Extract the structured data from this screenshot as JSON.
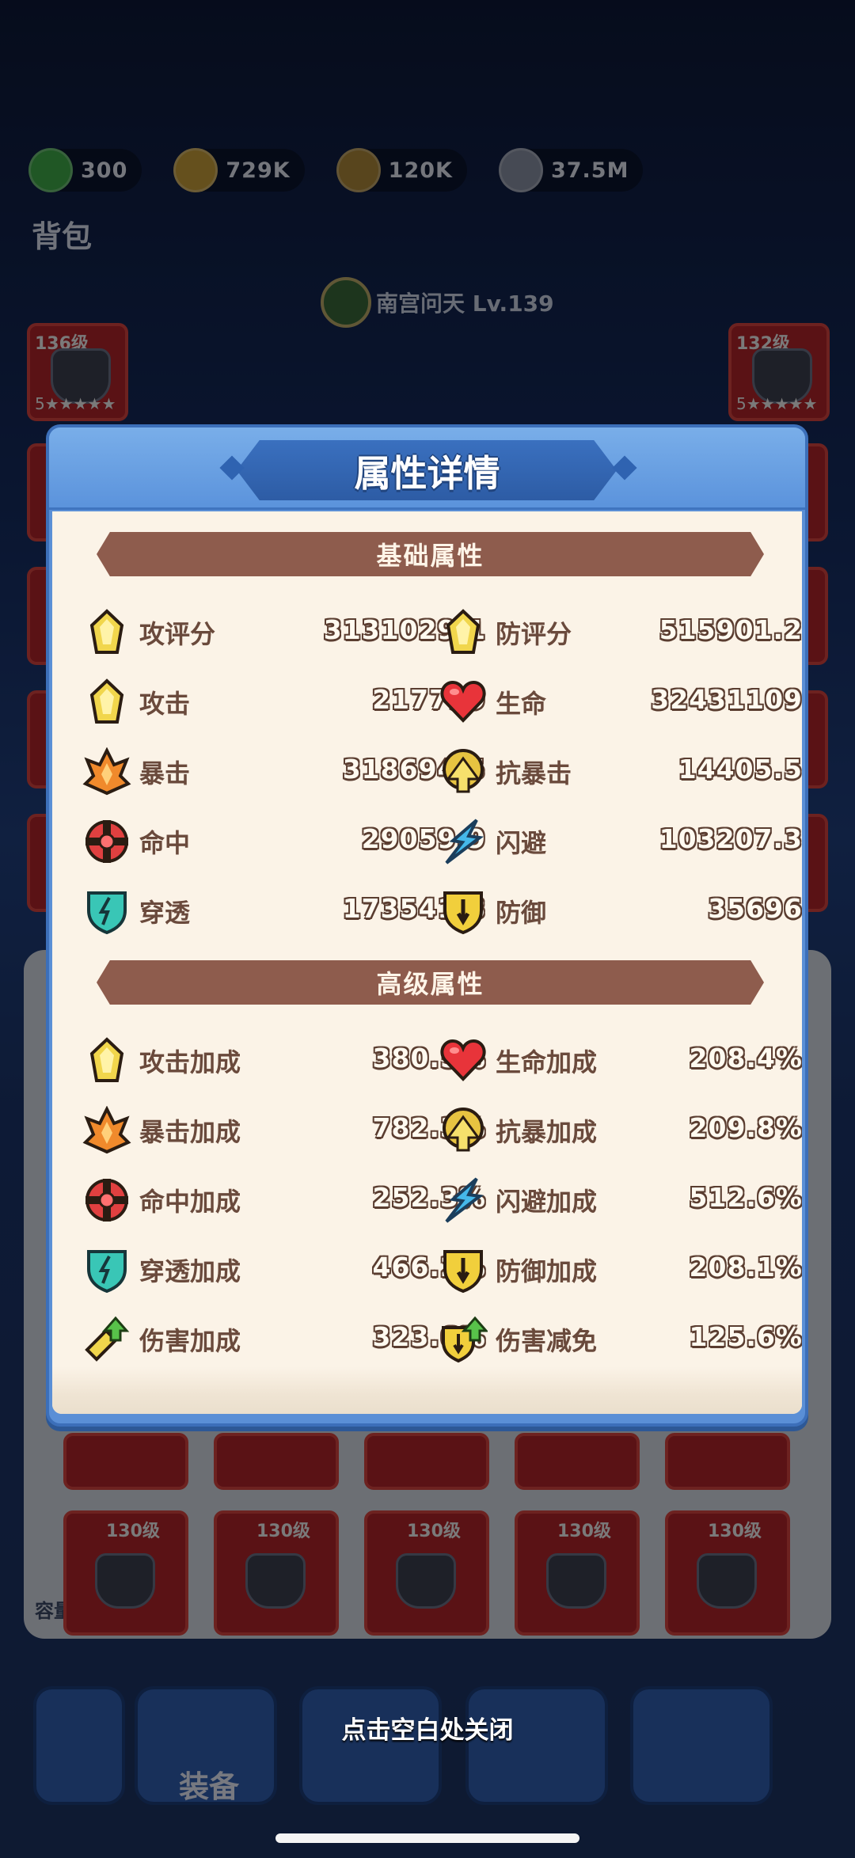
{
  "resources": [
    {
      "icon": "green-gem-icon",
      "value": "300",
      "color": "#3fae4a"
    },
    {
      "icon": "gold-coin-icon",
      "value": "729K",
      "color": "#caa13a"
    },
    {
      "icon": "bronze-coin-icon",
      "value": "120K",
      "color": "#b08a3a"
    },
    {
      "icon": "silver-coin-icon",
      "value": "37.5M",
      "color": "#8c93a8"
    }
  ],
  "bag_title": "背包",
  "hero": {
    "name": "南宫问天 Lv.139"
  },
  "equipment_slots": [
    {
      "level": "136级",
      "stars": "5★★★★★"
    },
    {
      "level": "132级",
      "stars": "5★★★★★"
    }
  ],
  "bottom_slots": [
    {
      "level": "130级"
    },
    {
      "level": "130级"
    },
    {
      "level": "130级"
    },
    {
      "level": "130级"
    },
    {
      "level": "130级"
    }
  ],
  "capacity": "容量: 189/300",
  "nav": {
    "equipment_label": "装备"
  },
  "modal": {
    "title": "属性详情",
    "basic_section": "基础属性",
    "advanced_section": "高级属性",
    "basic_stats": [
      {
        "left": {
          "icon": "attack-score-icon",
          "name": "攻评分",
          "value": "3131029.1"
        },
        "right": {
          "icon": "defense-score-icon",
          "name": "防评分",
          "value": "515901.2"
        }
      },
      {
        "left": {
          "icon": "attack-icon",
          "name": "攻击",
          "value": "217799"
        },
        "right": {
          "icon": "heart-icon",
          "name": "生命",
          "value": "32431109"
        }
      },
      {
        "left": {
          "icon": "crit-icon",
          "name": "暴击",
          "value": "318694.5"
        },
        "right": {
          "icon": "anti-crit-icon",
          "name": "抗暴击",
          "value": "14405.5"
        }
      },
      {
        "left": {
          "icon": "hit-icon",
          "name": "命中",
          "value": "29059.9"
        },
        "right": {
          "icon": "dodge-icon",
          "name": "闪避",
          "value": "103207.3"
        }
      },
      {
        "left": {
          "icon": "pierce-icon",
          "name": "穿透",
          "value": "173541.8"
        },
        "right": {
          "icon": "defense-icon",
          "name": "防御",
          "value": "35696"
        }
      }
    ],
    "advanced_stats": [
      {
        "left": {
          "icon": "attack-icon",
          "name": "攻击加成",
          "value": "380.5%"
        },
        "right": {
          "icon": "heart-icon",
          "name": "生命加成",
          "value": "208.4%"
        }
      },
      {
        "left": {
          "icon": "crit-icon",
          "name": "暴击加成",
          "value": "782.3%"
        },
        "right": {
          "icon": "anti-crit-icon",
          "name": "抗暴加成",
          "value": "209.8%"
        }
      },
      {
        "left": {
          "icon": "hit-icon",
          "name": "命中加成",
          "value": "252.3%"
        },
        "right": {
          "icon": "dodge-icon",
          "name": "闪避加成",
          "value": "512.6%"
        }
      },
      {
        "left": {
          "icon": "pierce-icon",
          "name": "穿透加成",
          "value": "466.2%"
        },
        "right": {
          "icon": "defense-icon",
          "name": "防御加成",
          "value": "208.1%"
        }
      },
      {
        "left": {
          "icon": "damage-bonus-icon",
          "name": "伤害加成",
          "value": "323.6%"
        },
        "right": {
          "icon": "damage-reduction-icon",
          "name": "伤害减免",
          "value": "125.6%"
        }
      }
    ]
  },
  "close_hint": "点击空白处关闭"
}
